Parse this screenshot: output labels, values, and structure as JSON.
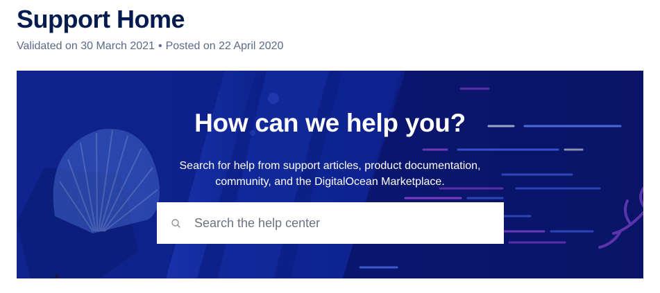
{
  "page": {
    "title": "Support Home",
    "validated": "Validated on 30 March 2021",
    "separator": "•",
    "posted": "Posted on 22 April 2020"
  },
  "hero": {
    "heading": "How can we help you?",
    "description": "Search for help from support articles, product documentation, community, and the DigitalOcean Marketplace.",
    "search": {
      "placeholder": "Search the help center",
      "value": "",
      "icon": "search-icon"
    }
  },
  "colors": {
    "title": "#031b4e",
    "meta": "#5b6987",
    "hero_background": "#0b1f8a",
    "hero_text": "#ffffff"
  }
}
